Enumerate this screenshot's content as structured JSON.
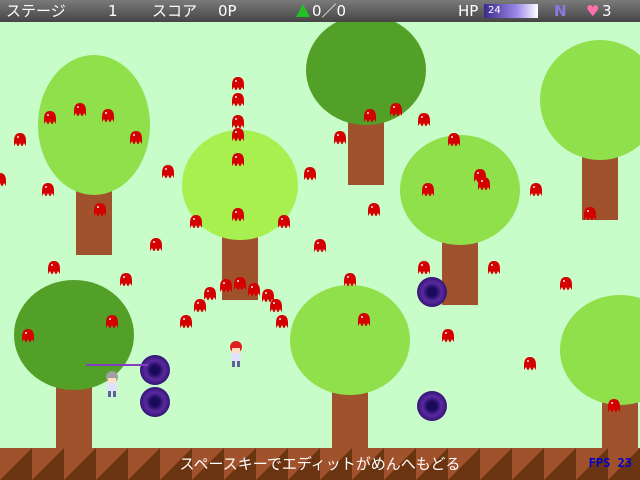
{
  "hud": {
    "stage_label": "ステージ",
    "stage_value": "1",
    "score_label": "スコア",
    "score_value": "0P",
    "tree_count": "0／0",
    "hp_label": "HP",
    "hp_value": "24",
    "mode_letter": "N",
    "lives": "3",
    "icons": [
      "tree-counter-icon",
      "heart-icon"
    ]
  },
  "footer": {
    "message": "スペースキーでエディットがめんへもどる",
    "fps": "FPS 23"
  },
  "colors": {
    "field": "#c8fcc8",
    "trunk": "#a0522d",
    "enemy": "#d40000",
    "ground": "#8b4513"
  }
}
